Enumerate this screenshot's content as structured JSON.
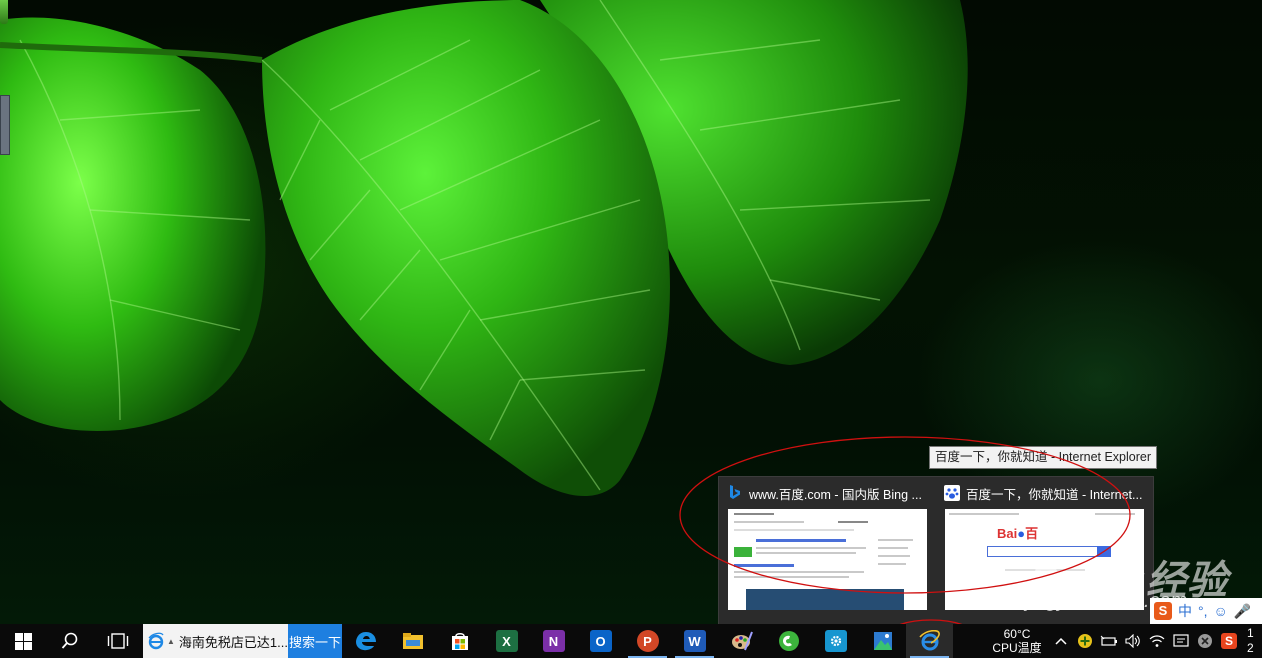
{
  "tooltip": {
    "text": "百度一下，你就知道 - Internet Explorer"
  },
  "thumbnails": [
    {
      "title": "www.百度.com - 国内版 Bing ...",
      "icon": "bing-icon"
    },
    {
      "title": "百度一下，你就知道 - Internet...",
      "icon": "baidu-paw-icon"
    }
  ],
  "baidu_preview": {
    "logo": "Bai",
    "logo_suffix": "百"
  },
  "watermark": {
    "brand": "Baidu经验",
    "url": "jingyan.baidu.com"
  },
  "ime_bar": {
    "mode": "中",
    "punct": "°,",
    "s_logo": "S"
  },
  "taskbar": {
    "search_text": "海南免税店已达1...",
    "search_button": "搜索一下",
    "apps": [
      "start-icon",
      "search-icon",
      "task-view-icon",
      "edge-icon",
      "file-explorer-icon",
      "store-icon",
      "excel-icon",
      "onenote-icon",
      "outlook-icon",
      "powerpoint-icon",
      "word-icon",
      "paint-icon",
      "360-browser-icon",
      "settings-app-icon",
      "photo-app-icon",
      "ie-icon"
    ],
    "app_letters": {
      "excel": "X",
      "onenote": "N",
      "outlook": "O",
      "powerpoint": "P",
      "word": "W"
    },
    "cpu_temp": "60°C",
    "cpu_label": "CPU温度",
    "clock_time": "1",
    "clock_date": "2"
  },
  "colors": {
    "accent": "#1e7fe0",
    "annotation": "#d01010",
    "leaf": "#3ad11a"
  }
}
